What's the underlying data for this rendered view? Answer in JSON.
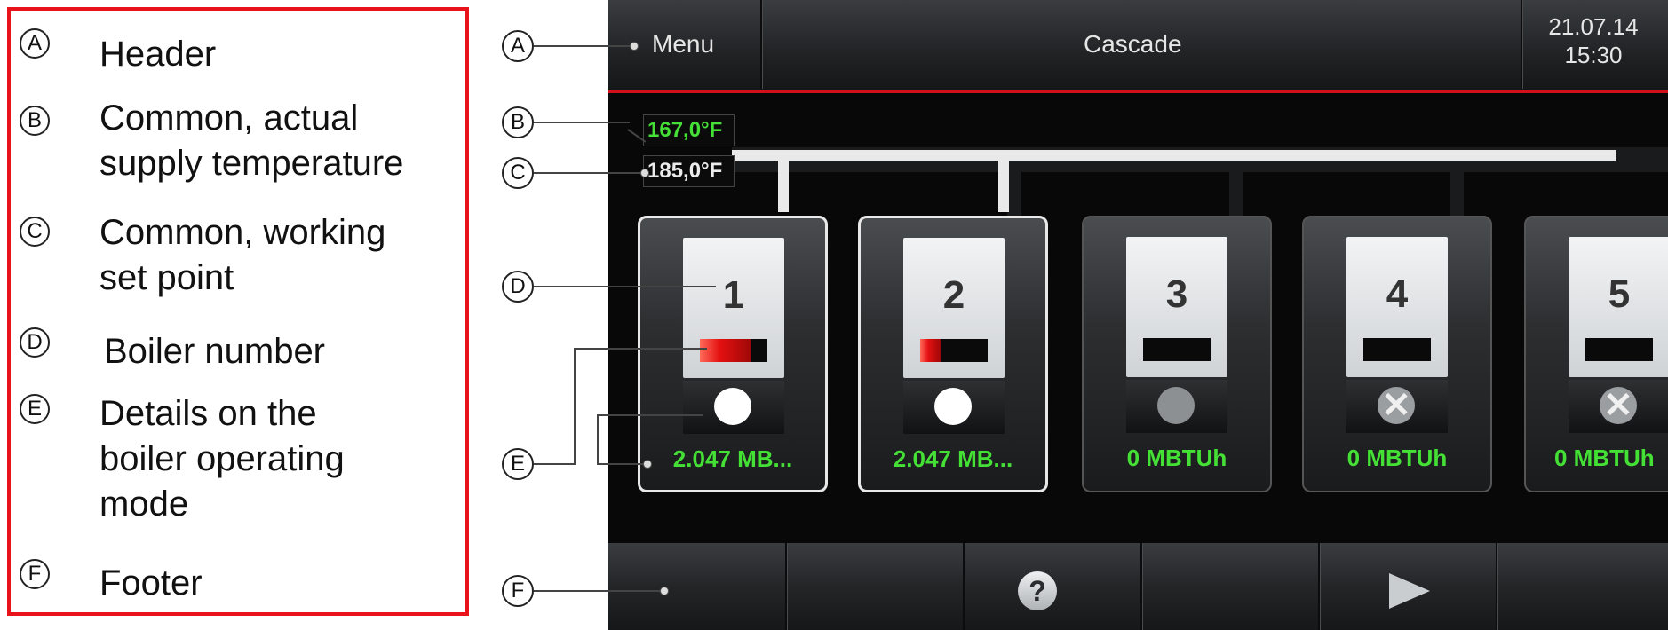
{
  "legend": {
    "items": [
      {
        "letter": "A",
        "text": "Header"
      },
      {
        "letter": "B",
        "text": "Common, actual\nsupply temperature"
      },
      {
        "letter": "C",
        "text": "Common, working\nset point"
      },
      {
        "letter": "D",
        "text": "Boiler number"
      },
      {
        "letter": "E",
        "text": "Details on the\nboiler operating\nmode"
      },
      {
        "letter": "F",
        "text": "Footer"
      }
    ]
  },
  "callouts": {
    "a": "A",
    "b": "B",
    "c": "C",
    "d": "D",
    "e": "E",
    "f": "F"
  },
  "header": {
    "menu_label": "Menu",
    "title": "Cascade",
    "date_time": "21.07.14\n15:30"
  },
  "supply": {
    "actual_temp": "167,0°F",
    "set_point": "185,0°F"
  },
  "boilers": [
    {
      "number": "1",
      "power": "2.047 MB...",
      "flame": 0.75,
      "state": "on"
    },
    {
      "number": "2",
      "power": "2.047 MB...",
      "flame": 0.3,
      "state": "on"
    },
    {
      "number": "3",
      "power": "0 MBTUh",
      "flame": 0,
      "state": "off"
    },
    {
      "number": "4",
      "power": "0 MBTUh",
      "flame": 0,
      "state": "disabled"
    },
    {
      "number": "5",
      "power": "0 MBTUh",
      "flame": 0,
      "state": "disabled"
    }
  ],
  "footer": {
    "help_icon": "?"
  },
  "colors": {
    "accent_red": "#d0101a",
    "value_green": "#44e036",
    "frame_red": "#e8131b"
  }
}
